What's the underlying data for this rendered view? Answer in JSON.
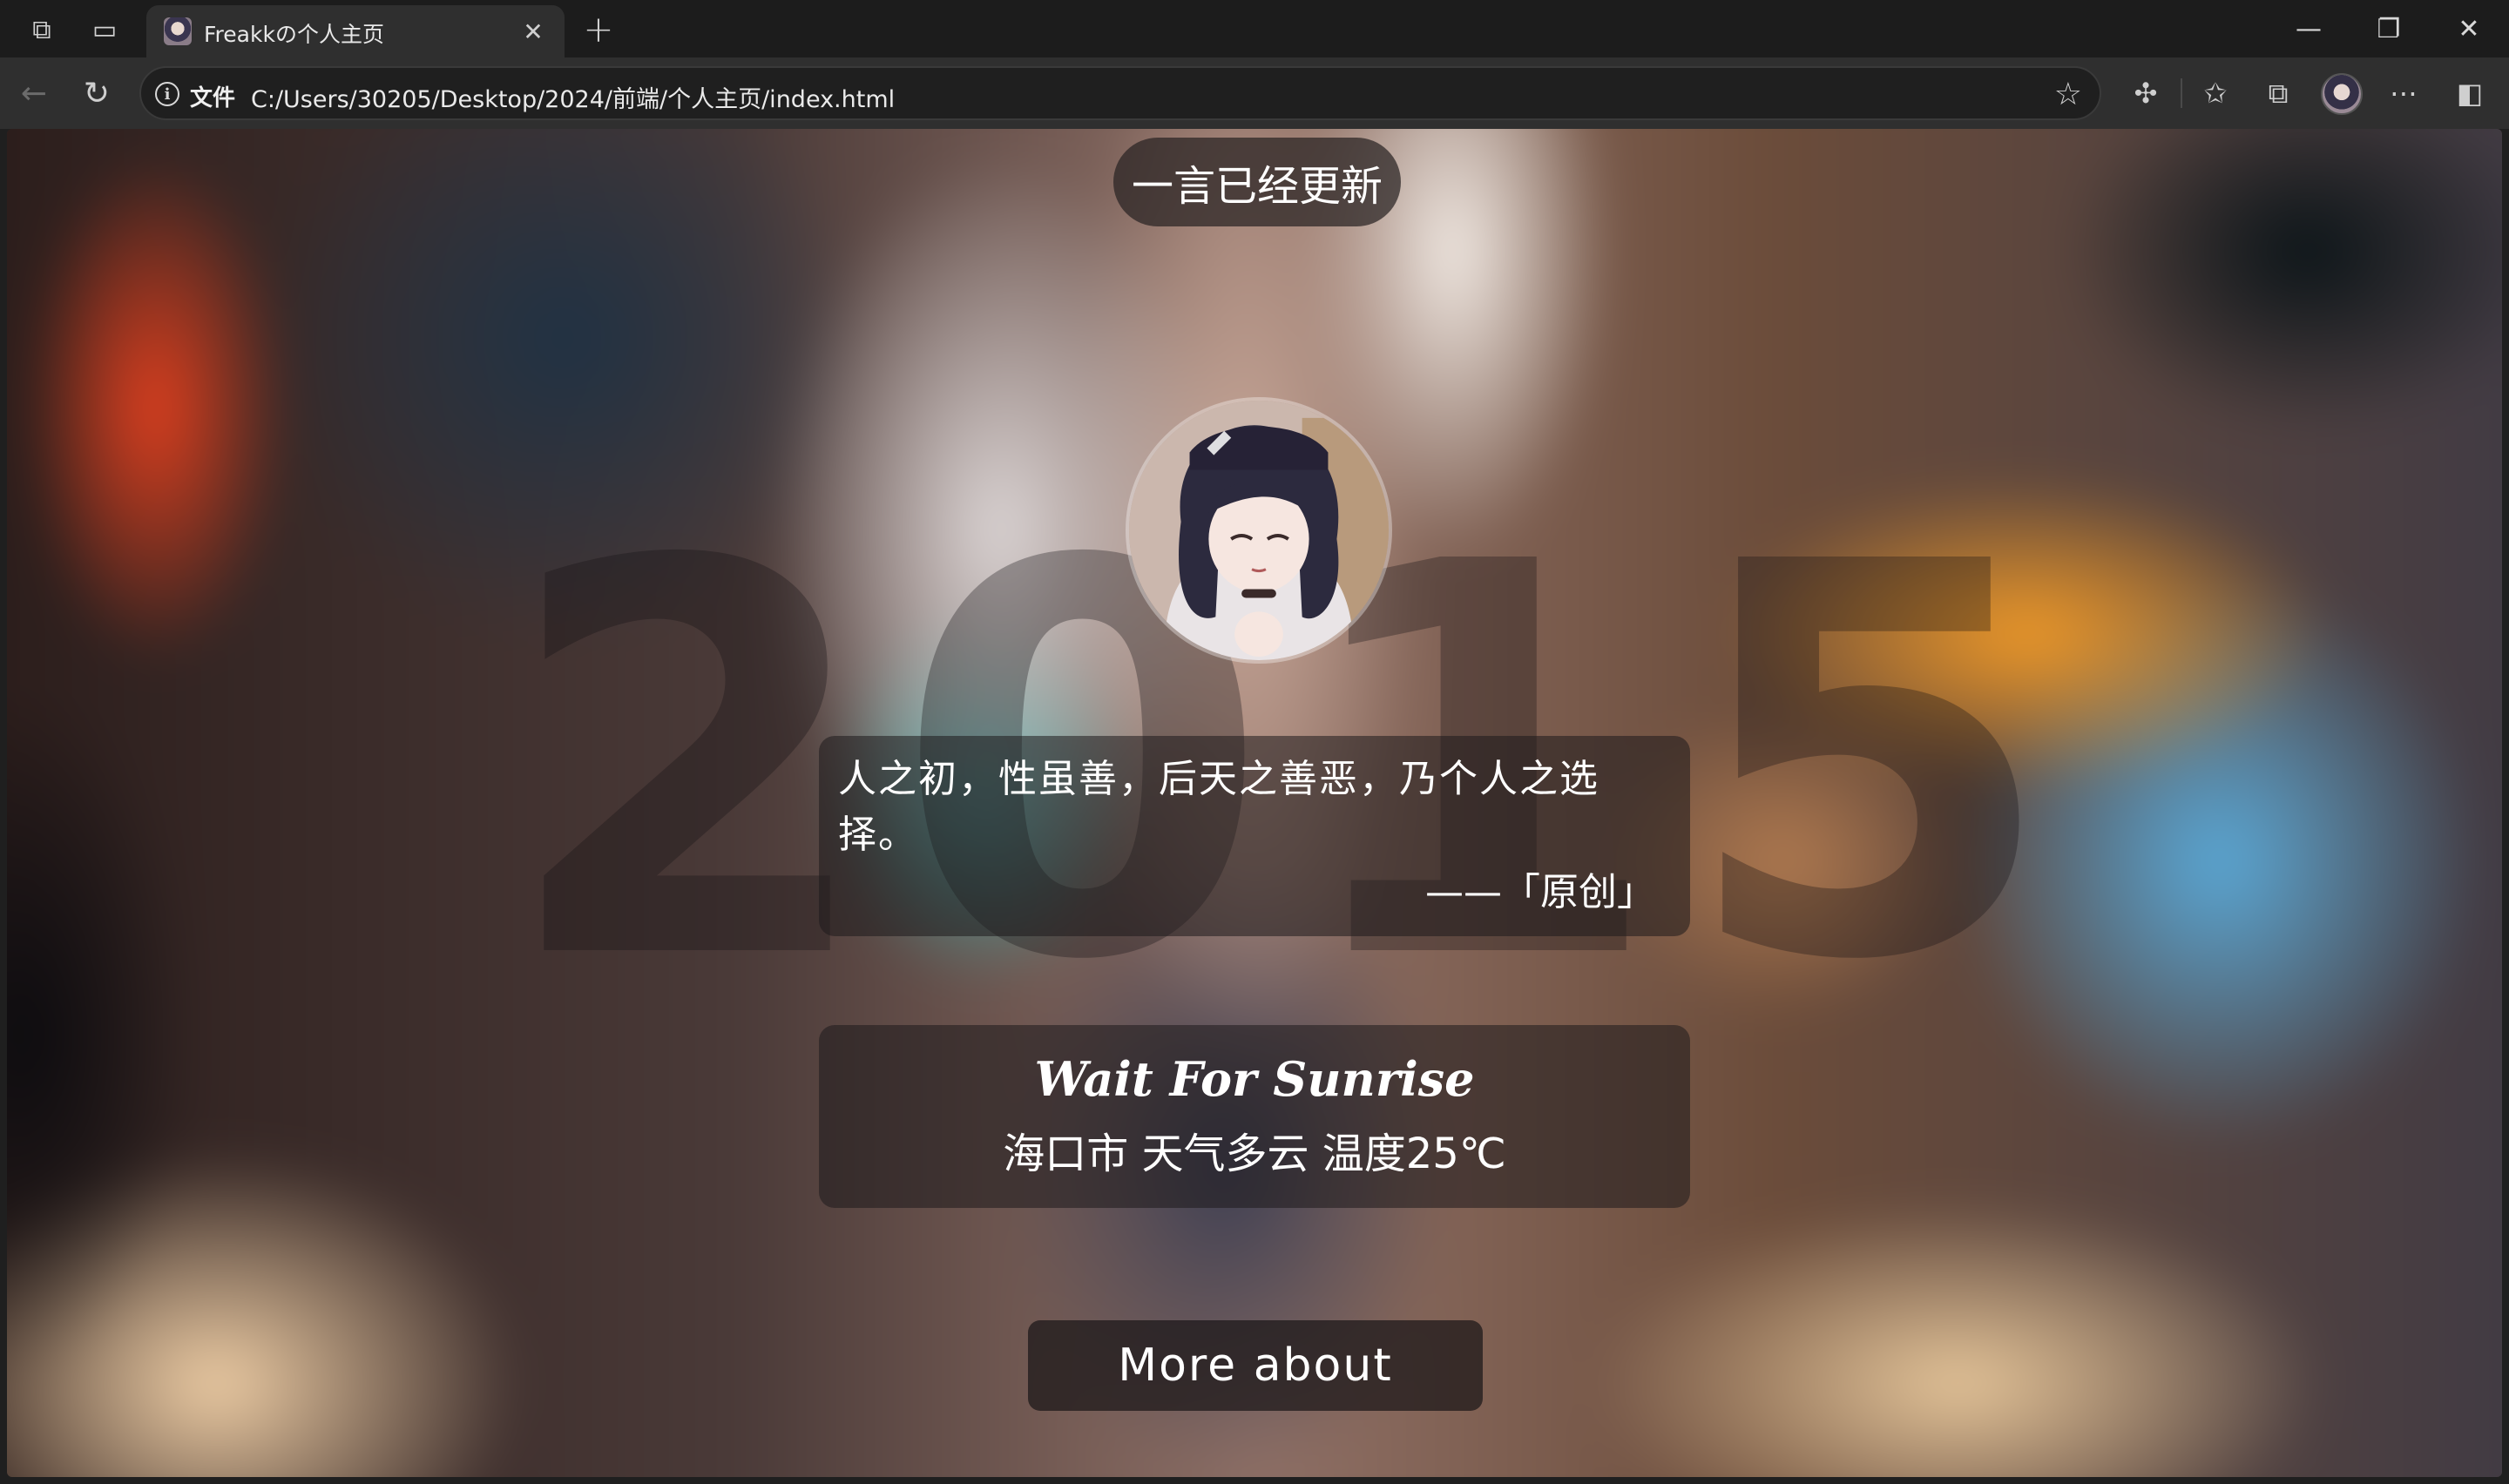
{
  "browser": {
    "tab_title": "Freakkの个人主页",
    "scheme_label": "文件",
    "url": "C:/Users/30205/Desktop/2024/前端/个人主页/index.html"
  },
  "page": {
    "toast": "一言已经更新",
    "year": "2015",
    "quote": {
      "text": "人之初，性虽善，后天之善恶，乃个人之选择。",
      "source": "——「原创」"
    },
    "weather": {
      "title": "Wait For Sunrise",
      "info": "海口市 天气多云 温度25℃"
    },
    "more_button": "More about"
  },
  "icons": {
    "workspaces": "workspaces-icon",
    "tab_actions": "tab-actions-icon",
    "back": "back-arrow-icon",
    "refresh": "refresh-icon",
    "info": "info-icon",
    "favorite": "star-icon",
    "extensions": "puzzle-icon",
    "favorites_bar": "favorites-icon",
    "collections": "collections-icon",
    "menu": "more-icon",
    "sidebar": "sidebar-icon"
  }
}
